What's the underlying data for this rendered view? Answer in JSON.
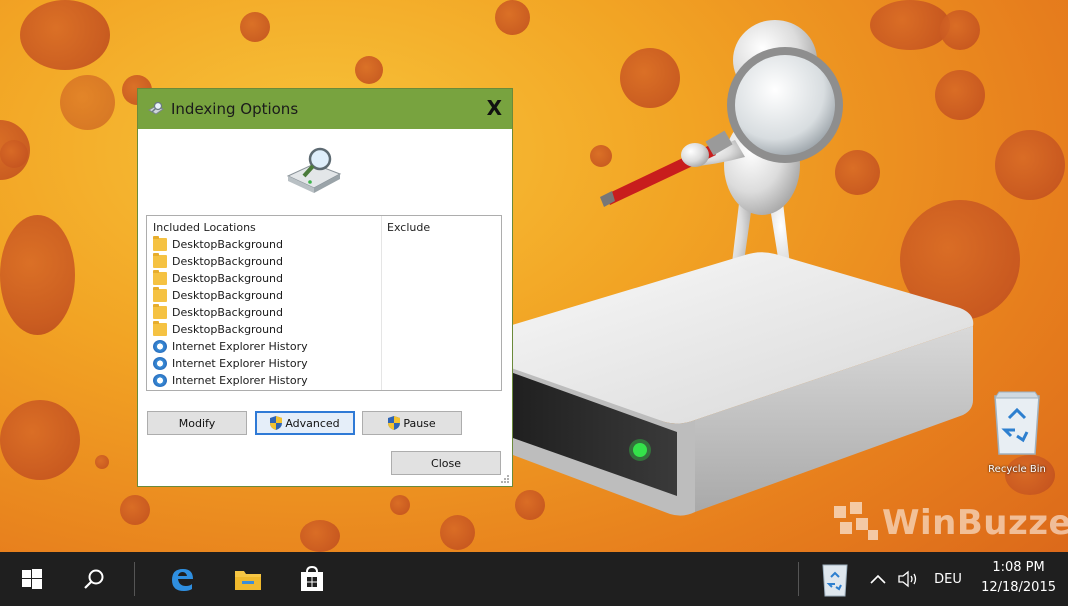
{
  "dialog": {
    "title": "Indexing Options",
    "close_label": "X",
    "columns": {
      "included": "Included Locations",
      "exclude": "Exclude"
    },
    "locations": [
      {
        "name": "DesktopBackground",
        "icon": "folder-icon"
      },
      {
        "name": "DesktopBackground",
        "icon": "folder-icon"
      },
      {
        "name": "DesktopBackground",
        "icon": "folder-icon"
      },
      {
        "name": "DesktopBackground",
        "icon": "folder-icon"
      },
      {
        "name": "DesktopBackground",
        "icon": "folder-icon"
      },
      {
        "name": "DesktopBackground",
        "icon": "folder-icon"
      },
      {
        "name": "Internet Explorer History",
        "icon": "internet-explorer-icon"
      },
      {
        "name": "Internet Explorer History",
        "icon": "internet-explorer-icon"
      },
      {
        "name": "Internet Explorer History",
        "icon": "internet-explorer-icon"
      }
    ],
    "buttons": {
      "modify": "Modify",
      "advanced": "Advanced",
      "pause": "Pause",
      "close": "Close"
    },
    "titlebar_color": "#78a33f"
  },
  "desktop": {
    "recycle_bin_label": "Recycle Bin",
    "watermark": "WinBuzzer"
  },
  "taskbar": {
    "language": "DEU",
    "time": "1:08 PM",
    "date": "12/18/2015",
    "icons": [
      "start-icon",
      "search-icon",
      "edge-icon",
      "file-explorer-icon",
      "store-icon",
      "recycle-bin-icon",
      "chevron-up-icon",
      "volume-icon"
    ]
  }
}
